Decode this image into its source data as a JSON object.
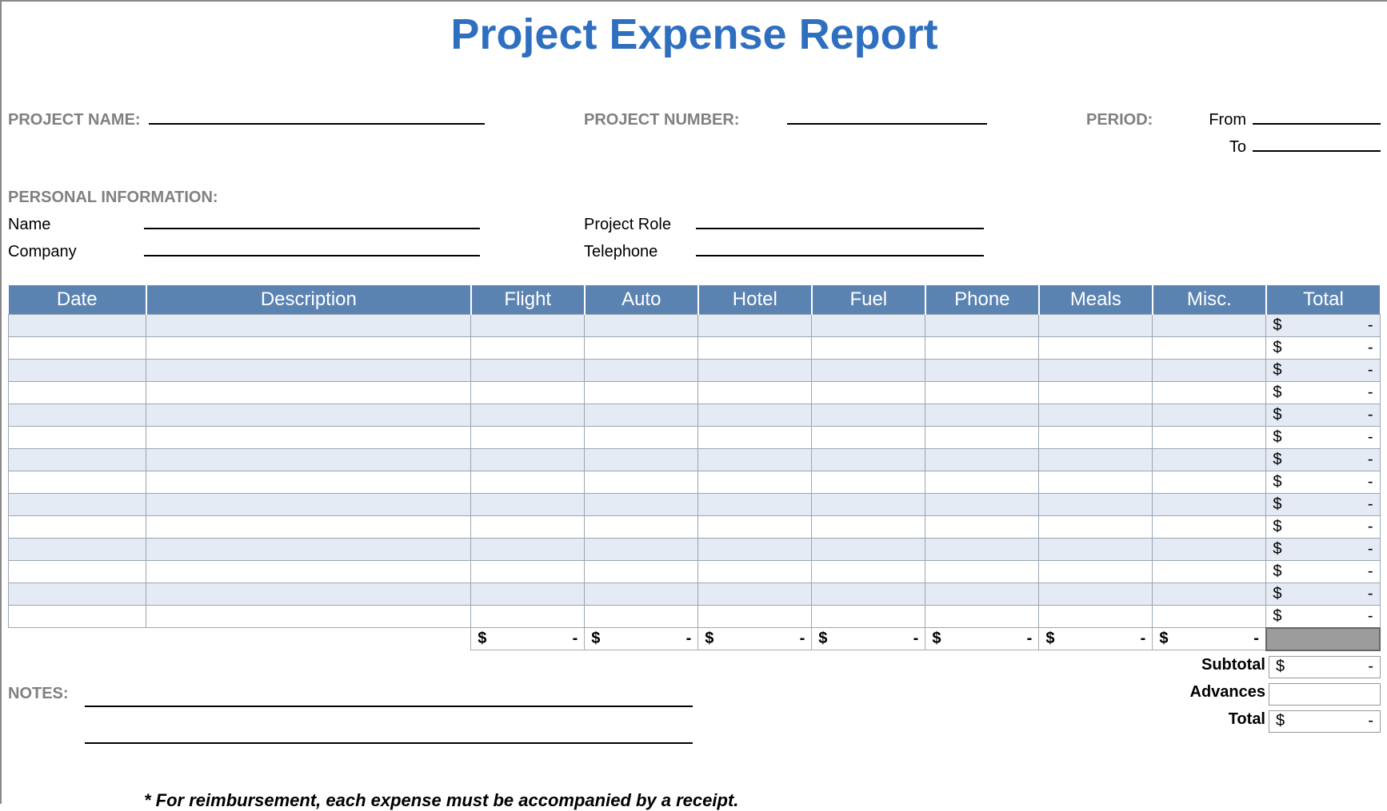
{
  "title": "Project Expense Report",
  "meta": {
    "project_name_label": "PROJECT NAME:",
    "project_number_label": "PROJECT NUMBER:",
    "period_label": "PERIOD:",
    "from_label": "From",
    "to_label": "To",
    "personal_info_label": "PERSONAL INFORMATION:",
    "name_label": "Name",
    "company_label": "Company",
    "project_role_label": "Project Role",
    "telephone_label": "Telephone",
    "project_name_value": "",
    "project_number_value": "",
    "period_from_value": "",
    "period_to_value": "",
    "name_value": "",
    "company_value": "",
    "project_role_value": "",
    "telephone_value": ""
  },
  "table": {
    "headers": [
      "Date",
      "Description",
      "Flight",
      "Auto",
      "Hotel",
      "Fuel",
      "Phone",
      "Meals",
      "Misc.",
      "Total"
    ],
    "row_count": 14,
    "currency_symbol": "$",
    "empty_value": "-",
    "column_totals_currency": "$",
    "column_totals_value": "-"
  },
  "summary": {
    "subtotal_label": "Subtotal",
    "subtotal_value": "-",
    "advances_label": "Advances",
    "advances_value": "",
    "total_label": "Total",
    "total_value": "-",
    "currency": "$"
  },
  "notes_label": "NOTES:",
  "footer_note": "* For reimbursement, each expense must be accompanied by a receipt."
}
